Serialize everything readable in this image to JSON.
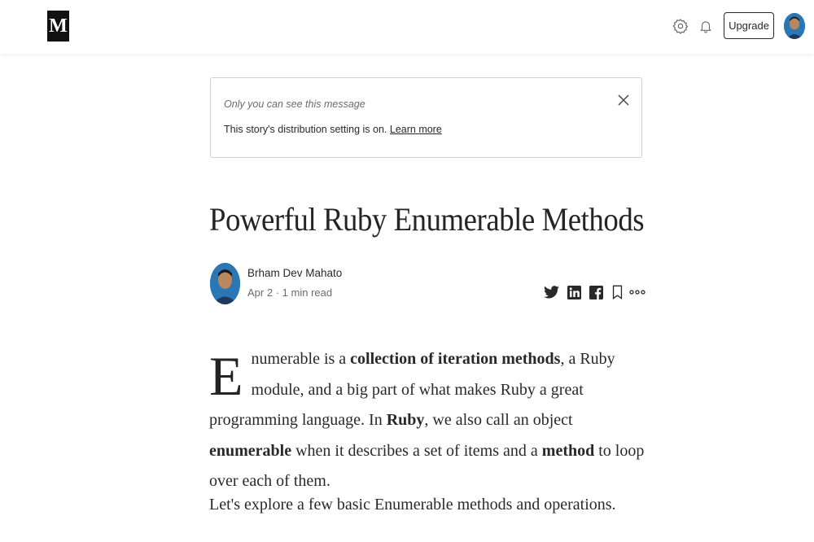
{
  "header": {
    "logo_text": "M",
    "icons": [
      "gear-icon",
      "bell-icon"
    ],
    "upgrade_label": "Upgrade"
  },
  "notice": {
    "visibility_text": "Only you can see this message",
    "message": "This story's distribution setting is on.",
    "link_label": "Learn more"
  },
  "article": {
    "title": "Powerful Ruby Enumerable Methods",
    "author": "Brham Dev Mahato",
    "date": "Apr 2",
    "separator": "·",
    "read_time": "1 min read",
    "share_icons": [
      "twitter-icon",
      "linkedin-icon",
      "facebook-icon",
      "bookmark-icon",
      "more-icon"
    ],
    "para1": {
      "dropcap": "E",
      "t1": "numerable is a ",
      "b1": "collection of iteration methods",
      "t2": ", a Ruby module, and a big part of what makes Ruby a great programming language. In ",
      "b2": "Ruby",
      "t3": ", we also call an object ",
      "b3": "enumerable",
      "t4": " when it describes a set of items and a ",
      "b4": "method",
      "t5": " to loop over each of them."
    },
    "para2": "Let's explore a few basic Enumerable methods and operations."
  },
  "colors": {
    "text": "#292929",
    "muted": "#6b6b6b",
    "border": "#cfcfcf",
    "avatar_bg": "#2b77b5"
  }
}
